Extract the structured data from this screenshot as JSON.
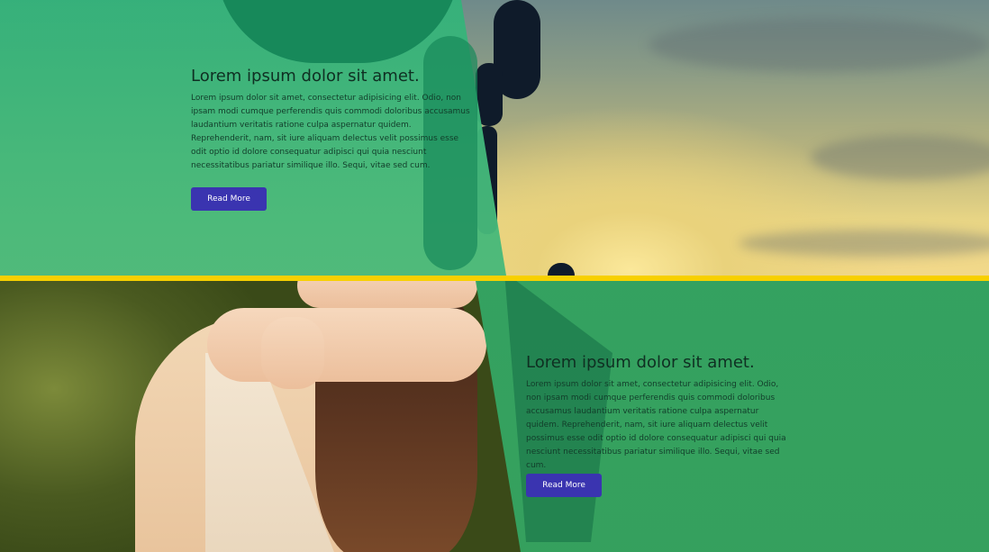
{
  "sections": [
    {
      "heading": "Lorem ipsum dolor sit amet.",
      "body": "Lorem ipsum dolor sit amet, consectetur adipisicing elit. Odio, non ipsam modi cumque perferendis quis commodi doloribus accusamus laudantium veritatis ratione culpa aspernatur quidem. Reprehenderit, nam, sit iure aliquam delectus velit possimus esse odit optio id dolore consequatur adipisci qui quia nesciunt necessitatibus pariatur similique illo. Sequi, vitae sed cum.",
      "button_label": "Read More"
    },
    {
      "heading": "Lorem ipsum dolor sit amet.",
      "body": "Lorem ipsum dolor sit amet, consectetur adipisicing elit. Odio, non ipsam modi cumque perferendis quis commodi doloribus accusamus laudantium veritatis ratione culpa aspernatur quidem. Reprehenderit, nam, sit iure aliquam delectus velit possimus esse odit optio id dolore consequatur adipisci qui quia nesciunt necessitatibus pariatur similique illo. Sequi, vitae sed cum.",
      "button_label": "Read More"
    }
  ],
  "colors": {
    "overlay_green": "#34b27a",
    "divider_yellow": "#f7d000",
    "button_blue": "#3a34b0"
  }
}
